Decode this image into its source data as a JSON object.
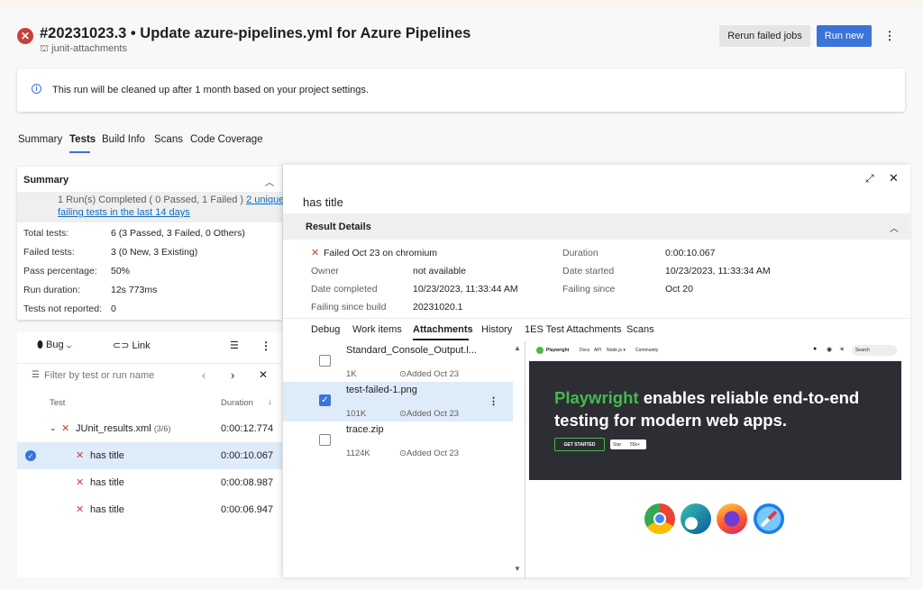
{
  "header": {
    "title": "#20231023.3 • Update azure-pipelines.yml for Azure Pipelines",
    "subtitle": "junit-attachments",
    "rerun_label": "Rerun failed jobs",
    "run_new_label": "Run new",
    "more_label": "⋮"
  },
  "banner": {
    "text": "This run will be cleaned up after 1 month based on your project settings."
  },
  "tabs": [
    "Summary",
    "Tests",
    "Build Info",
    "Scans",
    "Code Coverage"
  ],
  "summary": {
    "title": "Summary",
    "run_line": "1 Run(s) Completed ( 0 Passed, 1 Failed )",
    "unique_link": "2 unique",
    "unique_link_2": "failing tests in the last 14 days",
    "stats": [
      {
        "label": "Total tests:",
        "value": "6 (3 Passed, 3 Failed, 0 Others)"
      },
      {
        "label": "Failed tests:",
        "value": "3 (0 New, 3 Existing)"
      },
      {
        "label": "Pass percentage:",
        "value": "50%"
      },
      {
        "label": "Run duration:",
        "value": "12s 773ms"
      },
      {
        "label": "Tests not reported:",
        "value": "0"
      }
    ]
  },
  "list": {
    "bug_label": "Bug",
    "link_label": "Link",
    "filter_placeholder": "Filter by test or run name",
    "col_test": "Test",
    "col_duration": "Duration",
    "group": {
      "name": "JUnit_results.xml",
      "count": "(3/6)",
      "duration": "0:00:12.774"
    },
    "rows": [
      {
        "name": "has title",
        "duration": "0:00:10.067"
      },
      {
        "name": "has title",
        "duration": "0:00:08.987"
      },
      {
        "name": "has title",
        "duration": "0:00:06.947"
      }
    ]
  },
  "panel": {
    "title": "has title",
    "result_details_label": "Result Details",
    "failed_text": "Failed Oct 23 on chromium",
    "details": {
      "owner_label": "Owner",
      "owner": "not available",
      "completed_label": "Date completed",
      "completed": "10/23/2023, 11:33:44 AM",
      "failing_build_label": "Failing since build",
      "failing_build": "20231020.1",
      "duration_label": "Duration",
      "duration": "0:00:10.067",
      "started_label": "Date started",
      "started": "10/23/2023, 11:33:34 AM",
      "failing_since_label": "Failing since",
      "failing_since": "Oct 20"
    },
    "sub_tabs": [
      "Debug",
      "Work items",
      "Attachments",
      "History",
      "1ES Test Attachments",
      "Scans"
    ],
    "attachments": [
      {
        "name": "Standard_Console_Output.l...",
        "size": "1K",
        "added": "Added Oct 23"
      },
      {
        "name": "test-failed-1.png",
        "size": "101K",
        "added": "Added Oct 23"
      },
      {
        "name": "trace.zip",
        "size": "1124K",
        "added": "Added Oct 23"
      }
    ]
  },
  "preview": {
    "nav_brand": "Playwright",
    "nav_links": [
      "Docs",
      "API",
      "Node.js ▾",
      "Community"
    ],
    "nav_search": "Search",
    "headline_green": "Playwright",
    "headline_rest": " enables reliable end-to-end testing for modern web apps.",
    "cta": "GET STARTED",
    "star": "Star",
    "star_count": "55k+"
  },
  "colors": {
    "accent": "#3b73d9",
    "error": "#c9403b",
    "playwright_green": "#45ba4b",
    "hero_bg": "#2c2e33"
  }
}
